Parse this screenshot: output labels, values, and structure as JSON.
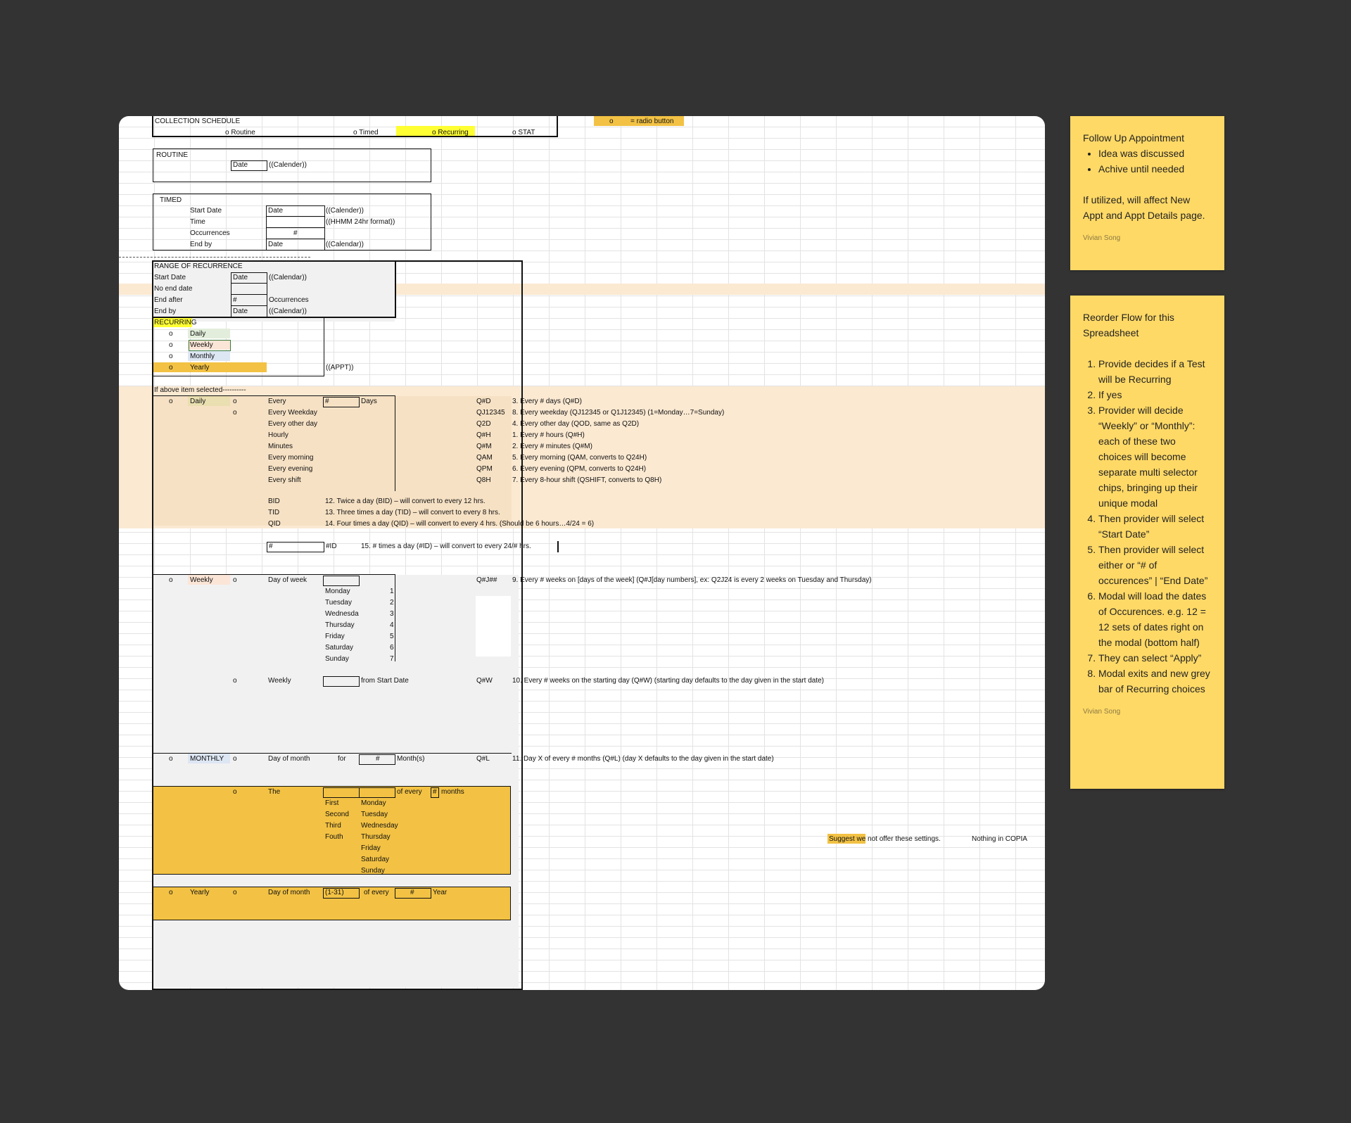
{
  "sheet": {
    "collection": {
      "title": "COLLECTION SCHEDULE",
      "routine": "o Routine",
      "timed": "o Timed",
      "recurring": "o   Recurring",
      "stat": "o    STAT",
      "legend_o": "o",
      "legend_text": "= radio button"
    },
    "routine": {
      "title": "ROUTINE",
      "date": "Date",
      "cal": "((Calender))"
    },
    "timed": {
      "title": "TIMED",
      "start": "Start Date",
      "time": "Time",
      "occ": "Occurrences",
      "endby": "End by",
      "date1": "Date",
      "hash": "#",
      "date2": "Date",
      "cal1": "((Calender))",
      "fmt": "((HHMM 24hr format))",
      "cal2": "((Calendar))"
    },
    "range": {
      "title": "RANGE OF RECURRENCE",
      "start": "Start Date",
      "noend": "No end date",
      "endafter": "End after",
      "endby": "End by",
      "date1": "Date",
      "hash": "#",
      "date2": "Date",
      "cal1": "((Calendar))",
      "occ": "Occurrences",
      "cal2": "((Calendar))"
    },
    "recurring": {
      "title": "RECURRING",
      "o": "o",
      "daily": "Daily",
      "weekly": "Weekly",
      "monthly": "Monthly",
      "yearly": "Yearly",
      "appt": "((APPT))"
    },
    "above": "If above item selected----------",
    "daily": {
      "o": "o",
      "label": "Daily",
      "items": [
        "Every",
        "Every Weekday",
        "Every other day",
        "Hourly",
        "Minutes",
        "Every morning",
        "Every evening",
        "Every shift"
      ],
      "hash": "#",
      "days": "Days",
      "codes": [
        "Q#D",
        "QJ12345",
        "Q2D",
        "Q#H",
        "Q#M",
        "QAM",
        "QPM",
        "Q8H"
      ],
      "desc": [
        "3. Every # days (Q#D)",
        "8. Every weekday (QJ12345 or Q1J12345) (1=Monday…7=Sunday)",
        "4. Every other day (QOD, same as Q2D)",
        "1. Every # hours (Q#H)",
        "2. Every # minutes (Q#M)",
        "5. Every morning (QAM, converts to Q24H)",
        "6. Every evening (QPM, converts to Q24H)",
        "7. Every 8-hour shift (QSHIFT, converts to Q8H)"
      ],
      "freq": [
        "BID",
        "TID",
        "QID"
      ],
      "freq_desc": [
        "12. Twice a day (BID) – will convert to every 12 hrs.",
        "13. Three times a day (TID) – will convert to every 8 hrs.",
        "14. Four times a day (QID) – will convert to every 4 hrs. (Should be 6 hours…4/24 = 6)"
      ],
      "nid_hash": "#",
      "nid": "#ID",
      "nid_desc": "15. # times a day (#ID) – will convert to every 24/# hrs."
    },
    "weekly": {
      "o": "o",
      "label": "Weekly",
      "dow": "Day of week",
      "days": [
        "Monday",
        "Tuesday",
        "Wednesda",
        "Thursday",
        "Friday",
        "Saturday",
        "Sunday"
      ],
      "nums": [
        "1",
        "2",
        "3",
        "4",
        "5",
        "6",
        "7"
      ],
      "code": "Q#J##",
      "desc": "9. Every # weeks on [days of the week] (Q#J[day numbers], ex: Q2J24 is every 2 weeks on Tuesday and Thursday)",
      "w2": "Weekly",
      "from": "from Start Date",
      "code2": "Q#W",
      "desc2": "10. Every # weeks on the starting day (Q#W) (starting day defaults to the day given in the start date)"
    },
    "monthly": {
      "o": "o",
      "label": "MONTHLY",
      "dom": "Day of month",
      "for": "for",
      "hash": "#",
      "months": "Month(s)",
      "code": "Q#L",
      "desc": "11. Day X of every # months (Q#L) (day X defaults to the day given in the start date)",
      "the": "The",
      "ofevery": "of every",
      "hash2": "#",
      "months2": "months",
      "ord": [
        "First",
        "Second",
        "Third",
        "Fouth"
      ],
      "wd": [
        "Monday",
        "Tuesday",
        "Wednesday",
        "Thursday",
        "Friday",
        "Saturday",
        "Sunday"
      ]
    },
    "yearly": {
      "o": "o",
      "label": "Yearly",
      "dom": "Day of month",
      "range": "(1-31)",
      "ofevery": "of every",
      "hash": "#",
      "year": "Year"
    },
    "suggest": "Suggest we not offer these settings.",
    "nothing": "Nothing in COPIA"
  },
  "note1": {
    "title": "Follow Up Appointment",
    "bullets": [
      "Idea was discussed",
      "Achive until needed"
    ],
    "body": "If utilized, will affect New Appt and Appt Details page.",
    "author": "Vivian Song"
  },
  "note2": {
    "title": "Reorder Flow for this Spreadsheet",
    "steps": [
      "Provide decides if a Test will be Recurring",
      "If yes",
      "Provider will decide “Weekly” or “Monthly”: each of these two choices will become separate multi selector chips, bringing up their unique modal",
      "Then provider will select “Start Date”",
      "Then provider will select either or “# of occurences” | “End Date”",
      "Modal will load the dates of Occurences. e.g. 12 = 12 sets of dates right on the modal (bottom half)",
      "They can select “Apply”",
      "Modal exits and new grey bar of Recurring choices"
    ],
    "author": "Vivian Song"
  },
  "colors": {
    "background": "#333333",
    "note": "#ffd966",
    "peach": "#f8e2c3",
    "gold": "#f3c244",
    "grey": "#f1f1f1",
    "highlight": "#ffff33"
  }
}
